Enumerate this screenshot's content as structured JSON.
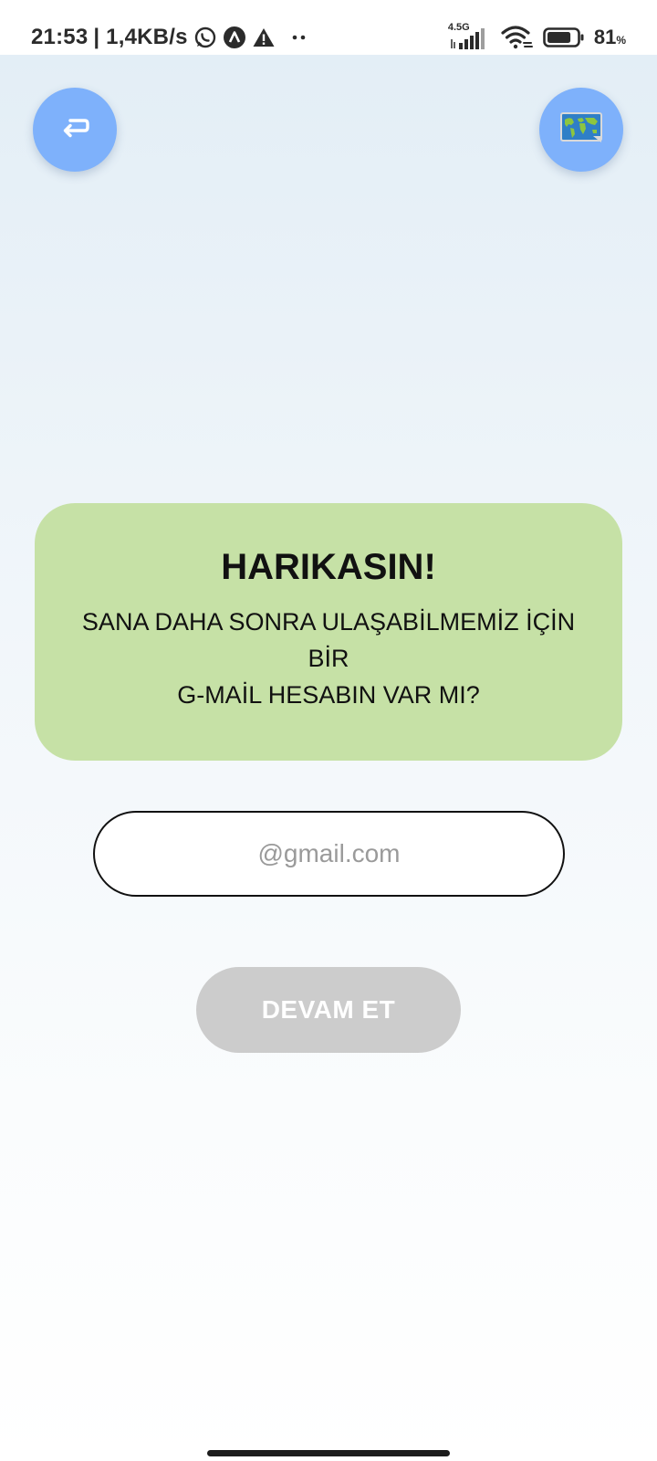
{
  "status_bar": {
    "time": "21:53",
    "speed": "| 1,4KB/s",
    "network_type": "4.5G",
    "battery_level": "81",
    "battery_unit": "%",
    "battery_fraction": 0.81,
    "icons": [
      "whatsapp-icon",
      "app-notification-icon",
      "warning-icon",
      "more-dots-icon",
      "signal-icon",
      "wifi-icon",
      "battery-icon"
    ]
  },
  "header": {
    "back_icon": "return-arrow-icon",
    "language_icon": "world-map-icon",
    "button_color": "#7eb1fb"
  },
  "card": {
    "title": "HARIKASIN!",
    "message_lines": [
      "SANA DAHA SONRA ULAŞABİLMEMİZ İÇİN",
      "BİR",
      "G-MAİL HESABIN VAR MI?"
    ],
    "background_color": "#c6e1a6"
  },
  "email": {
    "placeholder": "@gmail.com",
    "value": ""
  },
  "continue_button": {
    "label": "DEVAM ET",
    "state": "disabled",
    "color": "#cccccc"
  }
}
